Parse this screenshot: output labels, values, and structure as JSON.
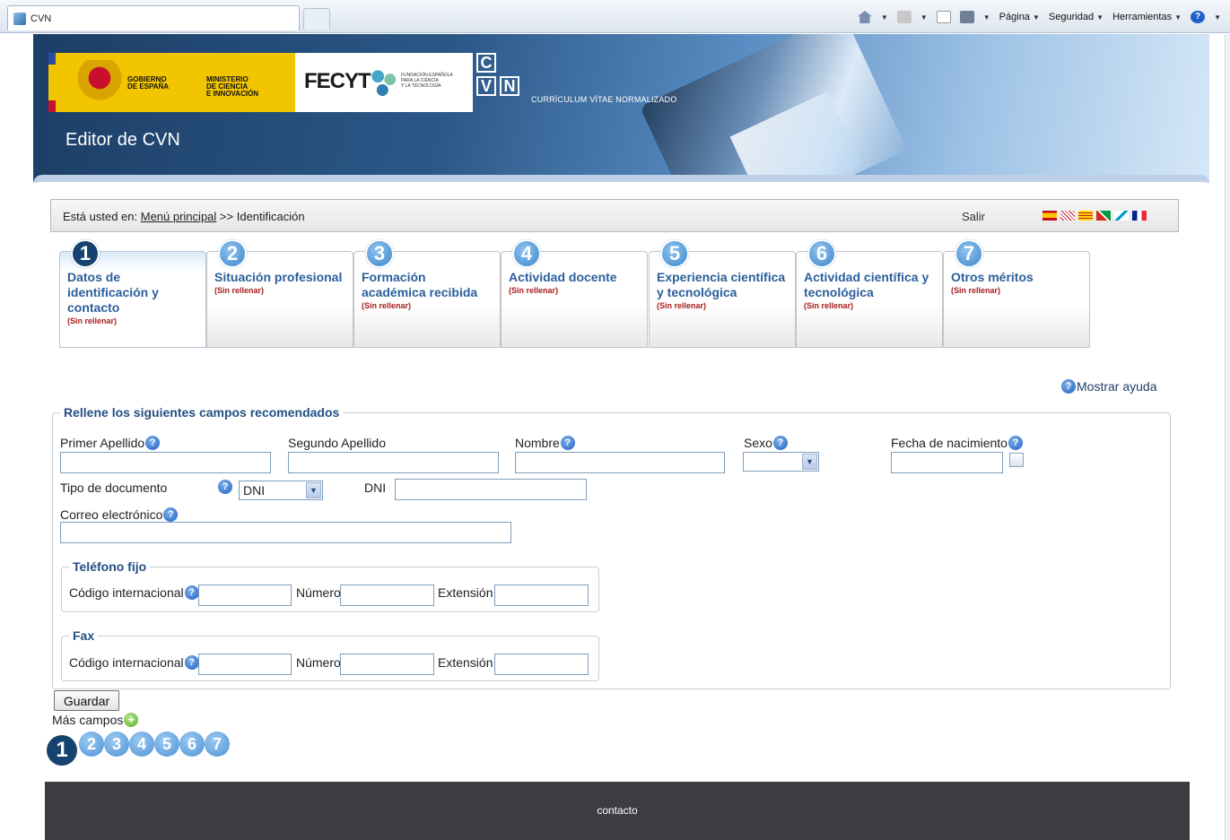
{
  "browser": {
    "tab_title": "CVN",
    "toolbar": {
      "page_label": "Página",
      "security_label": "Seguridad",
      "tools_label": "Herramientas"
    }
  },
  "header": {
    "gov_name": "GOBIERNO DE ESPAÑA",
    "gov_line1": "GOBIERNO",
    "gov_line2": "DE ESPAÑA",
    "ministry_line1": "MINISTERIO",
    "ministry_line2": "DE CIENCIA",
    "ministry_line3": "E INNOVACIÓN",
    "fecyt": "FECYT",
    "fecyt_sub1": "FUNDACIÓN ESPAÑOLA",
    "fecyt_sub2": "PARA LA CIENCIA",
    "fecyt_sub3": "Y LA TECNOLOGÍA",
    "cvn_letters": [
      "C",
      "V",
      "N"
    ],
    "cvn_caption": "CURRÍCULUM VÍTAE NORMALIZADO",
    "title": "Editor de CVN"
  },
  "breadcrumb": {
    "prefix": "Está usted en:",
    "link": "Menú principal",
    "sep": ">>",
    "current": "Identificación",
    "logout": "Salir"
  },
  "tabs": [
    {
      "num": "1",
      "title": "Datos de identificación y contacto",
      "status": "(Sin rellenar)"
    },
    {
      "num": "2",
      "title": "Situación profesional",
      "status": "(Sin rellenar)"
    },
    {
      "num": "3",
      "title": "Formación académica recibida",
      "status": "(Sin rellenar)"
    },
    {
      "num": "4",
      "title": "Actividad docente",
      "status": "(Sin rellenar)"
    },
    {
      "num": "5",
      "title": "Experiencia científica y tecnológica",
      "status": "(Sin rellenar)"
    },
    {
      "num": "6",
      "title": "Actividad científica y tecnológica",
      "status": "(Sin rellenar)"
    },
    {
      "num": "7",
      "title": "Otros méritos",
      "status": "(Sin rellenar)"
    }
  ],
  "help": {
    "show_help": "Mostrar ayuda"
  },
  "form": {
    "legend": "Rellene los siguientes campos recomendados",
    "first_surname": {
      "label": "Primer Apellido",
      "value": ""
    },
    "second_surname": {
      "label": "Segundo Apellido",
      "value": ""
    },
    "name": {
      "label": "Nombre",
      "value": ""
    },
    "sex": {
      "label": "Sexo",
      "value": ""
    },
    "birth_date": {
      "label": "Fecha de nacimiento",
      "value": ""
    },
    "doc_type": {
      "label": "Tipo de documento",
      "value": "DNI"
    },
    "dni": {
      "label": "DNI",
      "value": ""
    },
    "email": {
      "label": "Correo electrónico",
      "value": ""
    },
    "phone": {
      "legend": "Teléfono fijo",
      "intl_label": "Código internacional",
      "number_label": "Número",
      "ext_label": "Extensión"
    },
    "fax": {
      "legend": "Fax",
      "intl_label": "Código internacional",
      "number_label": "Número",
      "ext_label": "Extensión"
    }
  },
  "actions": {
    "save": "Guardar",
    "more_fields": "Más campos"
  },
  "steps": [
    "1",
    "2",
    "3",
    "4",
    "5",
    "6",
    "7"
  ],
  "footer": {
    "contact": "contacto"
  }
}
